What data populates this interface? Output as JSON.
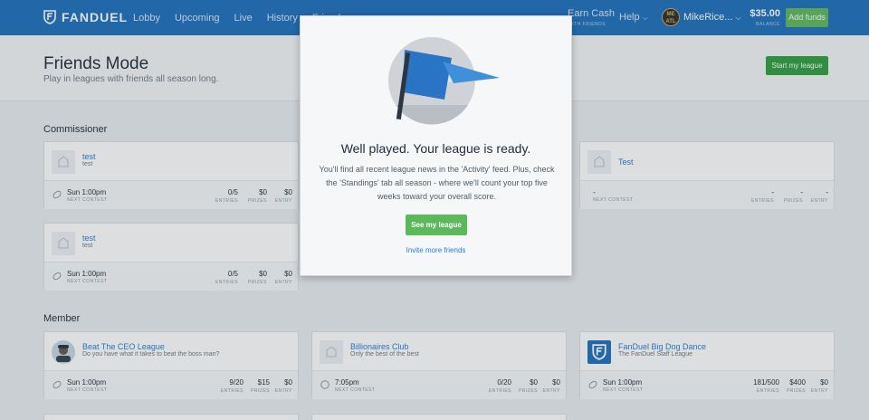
{
  "nav": {
    "logo": "FANDUEL",
    "items": [
      "Lobby",
      "Upcoming",
      "Live",
      "History",
      "Friends"
    ],
    "earn_cash": "Earn Cash",
    "earn_sub": "WITH FRIENDS",
    "help": "Help",
    "username": "MikeRice...",
    "avatar_text": "ME ATL",
    "balance": "$35.00",
    "balance_label": "BALANCE",
    "add_funds": "Add funds"
  },
  "header": {
    "title": "Friends Mode",
    "subtitle": "Play in leagues with friends all season long.",
    "start_button": "Start my league"
  },
  "sections": {
    "commissioner": "Commissioner",
    "member": "Member"
  },
  "labels": {
    "entries": "ENTRIES",
    "prizes": "PRIZES",
    "entry": "ENTRY",
    "next_contest": "NEXT CONTEST"
  },
  "commissioner_cards": [
    {
      "name": "test",
      "desc": "test",
      "time": "Sun 1:00pm",
      "entries": "0/5",
      "prizes": "$0",
      "entry": "$0"
    },
    {
      "name": "Test",
      "desc": "",
      "time": "-",
      "entries": "-",
      "prizes": "-",
      "entry": "-"
    },
    {
      "name": "test",
      "desc": "test",
      "time": "Sun 1:00pm",
      "entries": "0/5",
      "prizes": "$0",
      "entry": "$0"
    }
  ],
  "member_cards": [
    {
      "name": "Beat The CEO League",
      "desc": "Do you have what it takes to beat the boss man?",
      "time": "Sun 1:00pm",
      "entries": "9/20",
      "prizes": "$15",
      "entry": "$0"
    },
    {
      "name": "Billionaires Club",
      "desc": "Only the best of the best",
      "time": "7:05pm",
      "entries": "0/20",
      "prizes": "$0",
      "entry": "$0"
    },
    {
      "name": "FanDuel Big Dog Dance",
      "desc": "The FanDuel Staff League",
      "time": "Sun 1:00pm",
      "entries": "181/500",
      "prizes": "$400",
      "entry": "$0"
    }
  ],
  "modal": {
    "title": "Well played. Your league is ready.",
    "body": "You'll find all recent league news in the 'Activity' feed. Plus, check the 'Standings' tab all season - where we'll count your top five weeks toward your overall score.",
    "button": "See my league",
    "link": "Invite more friends"
  },
  "colors": {
    "brand": "#1d6fbd",
    "accent_green": "#5db85c",
    "link_blue": "#2a7bd4"
  }
}
